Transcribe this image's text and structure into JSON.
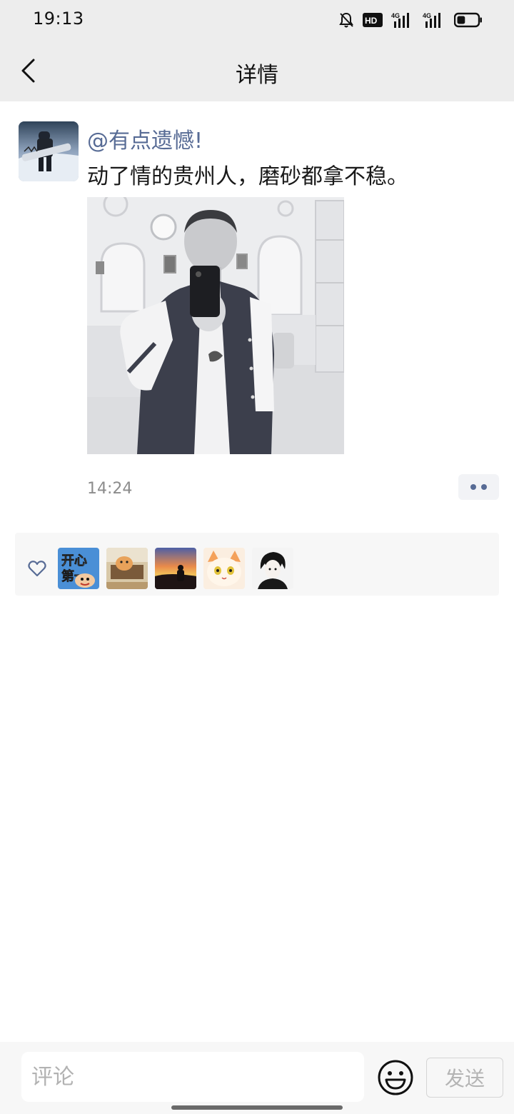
{
  "status_bar": {
    "time": "19:13",
    "icons": [
      "mute-bell-icon",
      "hd-icon",
      "signal-4g-icon",
      "signal-4g-icon",
      "battery-icon"
    ],
    "hd_label": "HD",
    "network_label": "4G",
    "battery_level": 0.4
  },
  "nav": {
    "title": "详情",
    "back_icon": "chevron-left-icon"
  },
  "post": {
    "username": "@有点遗憾!",
    "text": "动了情的贵州人，磨砂都拿不稳。",
    "time": "14:24",
    "more_icon": "more-dots-icon"
  },
  "likes": {
    "heart_icon": "heart-outline-icon",
    "avatar_1_text_line1": "开心",
    "avatar_1_text_line2": "第一",
    "avatar_count": 5
  },
  "comment_bar": {
    "placeholder": "评论",
    "emoji_icon": "smiley-icon",
    "send_label": "发送"
  },
  "colors": {
    "link": "#576b95",
    "bar_bg": "#ededed",
    "panel_bg": "#f7f7f7"
  }
}
